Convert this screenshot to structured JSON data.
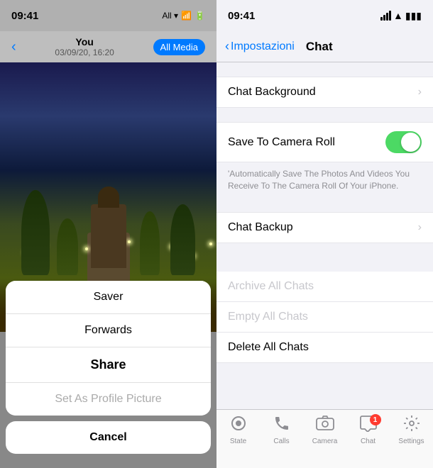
{
  "left": {
    "status_bar": {
      "time": "09:41",
      "network": "All ▾",
      "wifi": "WiFi",
      "battery": "Battery"
    },
    "nav": {
      "back_icon": "‹",
      "user_name": "You",
      "date": "03/09/20, 16:20",
      "all_media_label": "All Media"
    },
    "action_sheet": {
      "items": [
        {
          "label": "Saver",
          "disabled": false,
          "bold": false
        },
        {
          "label": "Forwards",
          "disabled": false,
          "bold": false
        },
        {
          "label": "Share",
          "disabled": false,
          "bold": true
        },
        {
          "label": "Set As Profile Picture",
          "disabled": true,
          "bold": false
        }
      ],
      "cancel_label": "Cancel"
    }
  },
  "right": {
    "status_bar": {
      "time": "09:41"
    },
    "nav": {
      "back_label": "Impostazioni",
      "title": "Chat"
    },
    "sections": [
      {
        "rows": [
          {
            "label": "Chat Background",
            "type": "chevron"
          }
        ]
      },
      {
        "rows": [
          {
            "label": "Save To Camera Roll",
            "type": "toggle",
            "enabled": true
          }
        ],
        "description": "'Automatically Save The Photos And Videos You Receive To The Camera Roll Of Your iPhone."
      },
      {
        "rows": [
          {
            "label": "Chat Backup",
            "type": "chevron"
          }
        ]
      },
      {
        "rows": [
          {
            "label": "Archive All Chats",
            "type": "disabled"
          },
          {
            "label": "Empty All Chats",
            "type": "disabled"
          },
          {
            "label": "Delete All Chats",
            "type": "normal"
          }
        ]
      }
    ],
    "tab_bar": {
      "tabs": [
        {
          "label": "State",
          "icon": "⟳",
          "active": false,
          "badge": null
        },
        {
          "label": "Calls",
          "icon": "✆",
          "active": false,
          "badge": null
        },
        {
          "label": "Camera",
          "icon": "⬤",
          "active": false,
          "badge": null
        },
        {
          "label": "Chat",
          "icon": "💬",
          "active": false,
          "badge": "1"
        },
        {
          "label": "Settings",
          "icon": "⚙",
          "active": false,
          "badge": null
        }
      ]
    }
  }
}
